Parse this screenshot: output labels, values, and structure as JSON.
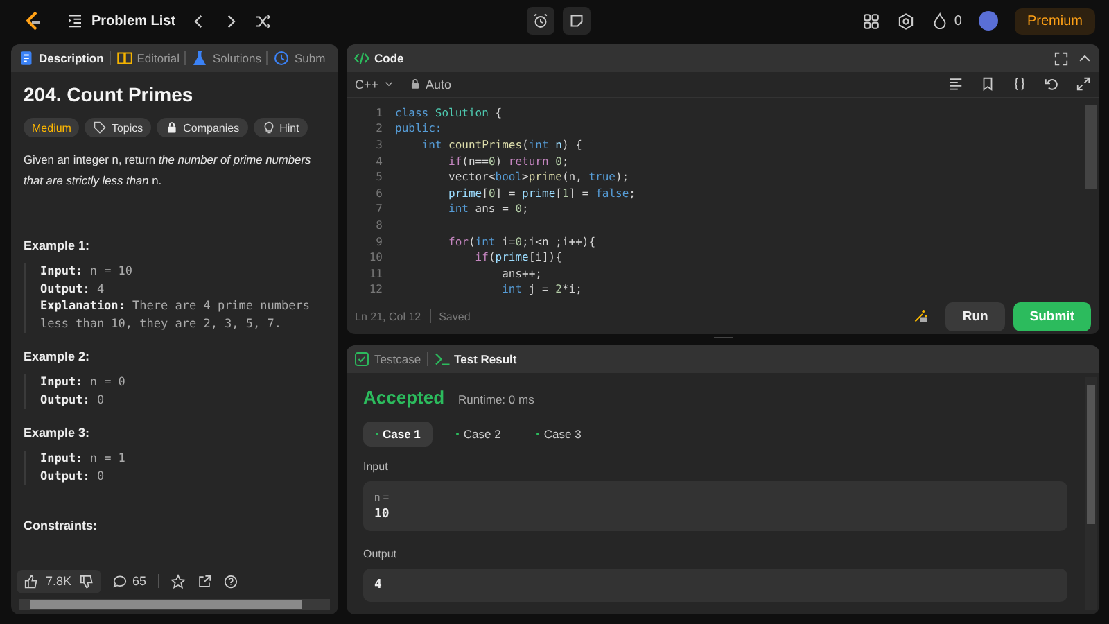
{
  "top_bar": {
    "title": "Problem List",
    "streak": "0",
    "premium": "Premium"
  },
  "description_panel": {
    "tabs": [
      {
        "label": "Description",
        "kind": "doc",
        "selected": true
      },
      {
        "label": "Editorial",
        "kind": "book",
        "selected": false
      },
      {
        "label": "Solutions",
        "kind": "flask",
        "selected": false
      },
      {
        "label": "Subm",
        "kind": "clock",
        "selected": false
      }
    ],
    "title": "204. Count Primes",
    "tags": [
      {
        "label": "Medium",
        "kind": "difficulty"
      },
      {
        "label": "Topics",
        "kind": "topics"
      },
      {
        "label": "Companies",
        "kind": "companies"
      },
      {
        "label": "Hint",
        "kind": "hint"
      }
    ],
    "statement": "Given an integer n, return *the number of prime numbers that are strictly less than* n.",
    "examples": [
      {
        "heading": "Example 1:",
        "lines": [
          "**Input:** n = 10",
          "**Output:** 4",
          "**Explanation:** There are 4 prime numbers less than 10, they are 2, 3, 5, 7."
        ]
      },
      {
        "heading": "Example 2:",
        "lines": [
          "**Input:** n = 0",
          "**Output:** 0"
        ]
      },
      {
        "heading": "Example 3:",
        "lines": [
          "**Input:** n = 1",
          "**Output:** 0"
        ]
      }
    ],
    "constraints_heading": "Constraints:",
    "likes": "7.8K",
    "comments": "65"
  },
  "code_panel": {
    "title": "Code",
    "language": "C++",
    "mode": "Auto",
    "lines": [
      {
        "number": "1",
        "tokens": [
          {
            "kind": "keyword",
            "text": "class"
          },
          {
            "kind": "type",
            "text": " Solution"
          },
          {
            "kind": "plain",
            "text": " {"
          }
        ]
      },
      {
        "number": "2",
        "tokens": [
          {
            "kind": "keyword",
            "text": "public:"
          }
        ]
      },
      {
        "number": "3",
        "tokens": [
          {
            "kind": "keyword",
            "text": "    int"
          },
          {
            "kind": "function",
            "text": " countPrimes"
          },
          {
            "kind": "plain",
            "text": "("
          },
          {
            "kind": "keyword",
            "text": "int"
          },
          {
            "kind": "variable",
            "text": " n"
          },
          {
            "kind": "plain",
            "text": ") {"
          }
        ]
      },
      {
        "number": "4",
        "tokens": [
          {
            "kind": "control",
            "text": "        if"
          },
          {
            "kind": "plain",
            "text": "(n=="
          },
          {
            "kind": "number",
            "text": "0"
          },
          {
            "kind": "plain",
            "text": ") "
          },
          {
            "kind": "control",
            "text": "return"
          },
          {
            "kind": "number",
            "text": " 0"
          },
          {
            "kind": "plain",
            "text": ";"
          }
        ]
      },
      {
        "number": "5",
        "tokens": [
          {
            "kind": "plain",
            "text": "        vector<"
          },
          {
            "kind": "keyword",
            "text": "bool"
          },
          {
            "kind": "plain",
            "text": ">"
          },
          {
            "kind": "function",
            "text": "prime"
          },
          {
            "kind": "plain",
            "text": "(n, "
          },
          {
            "kind": "keyword",
            "text": "true"
          },
          {
            "kind": "plain",
            "text": ");"
          }
        ]
      },
      {
        "number": "6",
        "tokens": [
          {
            "kind": "variable",
            "text": "        prime"
          },
          {
            "kind": "plain",
            "text": "["
          },
          {
            "kind": "number",
            "text": "0"
          },
          {
            "kind": "plain",
            "text": "] = "
          },
          {
            "kind": "variable",
            "text": "prime"
          },
          {
            "kind": "plain",
            "text": "["
          },
          {
            "kind": "number",
            "text": "1"
          },
          {
            "kind": "plain",
            "text": "] = "
          },
          {
            "kind": "keyword",
            "text": "false"
          },
          {
            "kind": "plain",
            "text": ";"
          }
        ]
      },
      {
        "number": "7",
        "tokens": [
          {
            "kind": "keyword",
            "text": "        int"
          },
          {
            "kind": "plain",
            "text": " ans = "
          },
          {
            "kind": "number",
            "text": "0"
          },
          {
            "kind": "plain",
            "text": ";"
          }
        ]
      },
      {
        "number": "8"
      },
      {
        "number": "9",
        "tokens": [
          {
            "kind": "control",
            "text": "        for"
          },
          {
            "kind": "plain",
            "text": "("
          },
          {
            "kind": "keyword",
            "text": "int"
          },
          {
            "kind": "plain",
            "text": " i="
          },
          {
            "kind": "number",
            "text": "0"
          },
          {
            "kind": "plain",
            "text": ";i<n ;i++){"
          }
        ]
      },
      {
        "number": "10",
        "tokens": [
          {
            "kind": "control",
            "text": "            if"
          },
          {
            "kind": "plain",
            "text": "("
          },
          {
            "kind": "variable",
            "text": "prime"
          },
          {
            "kind": "plain",
            "text": "[i]){"
          }
        ]
      },
      {
        "number": "11",
        "tokens": [
          {
            "kind": "plain",
            "text": "                ans++;"
          }
        ]
      },
      {
        "number": "12",
        "tokens": [
          {
            "kind": "keyword",
            "text": "                int"
          },
          {
            "kind": "plain",
            "text": " j = "
          },
          {
            "kind": "number",
            "text": "2"
          },
          {
            "kind": "plain",
            "text": "*i;"
          }
        ]
      }
    ],
    "cursor": "Ln 21, Col 12",
    "save_state": "Saved",
    "run": "Run",
    "submit": "Submit"
  },
  "test_panel": {
    "tabs": [
      {
        "label": "Testcase",
        "kind": "check",
        "selected": false
      },
      {
        "label": "Test Result",
        "kind": "terminal",
        "selected": true
      }
    ],
    "verdict": "Accepted",
    "runtime": "Runtime: 0 ms",
    "cases": [
      {
        "label": "Case 1",
        "selected": true
      },
      {
        "label": "Case 2",
        "selected": false
      },
      {
        "label": "Case 3",
        "selected": false
      }
    ],
    "input_label": "Input",
    "input_var": "n =",
    "input_value": "10",
    "output_label": "Output",
    "output_value": "4"
  }
}
